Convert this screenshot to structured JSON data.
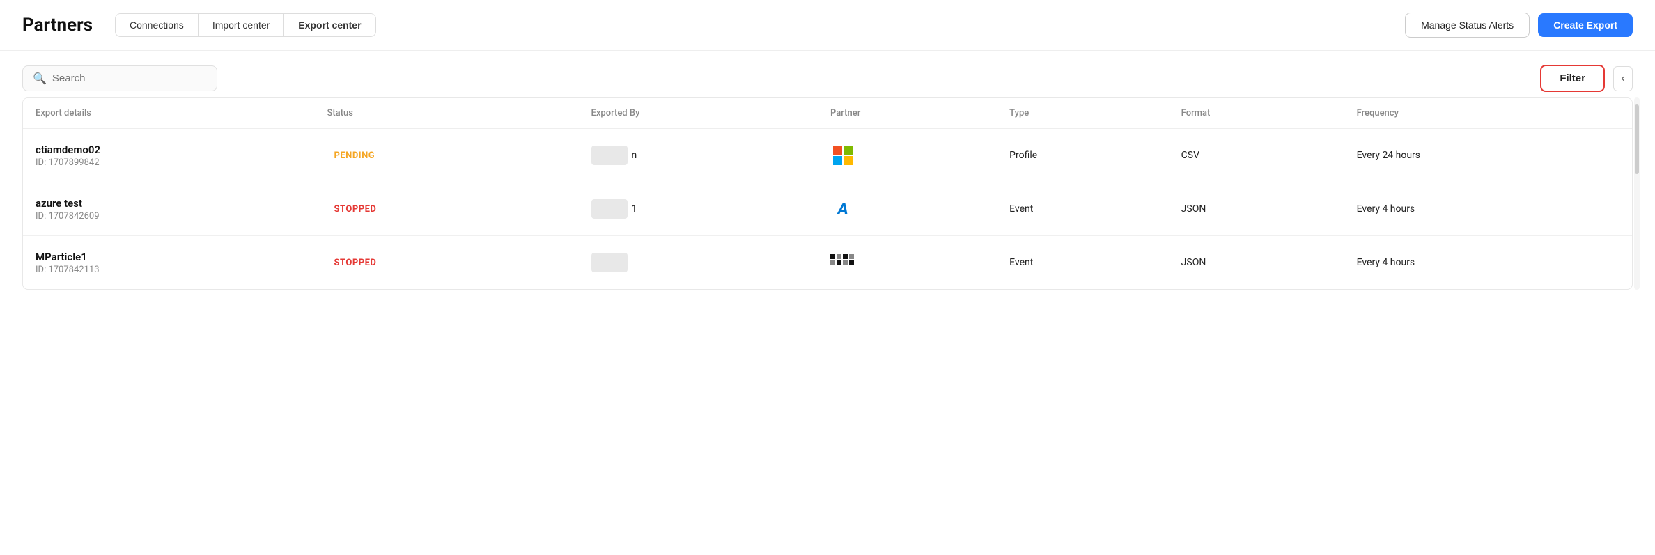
{
  "header": {
    "title": "Partners",
    "tabs": [
      {
        "id": "connections",
        "label": "Connections",
        "active": false
      },
      {
        "id": "import-center",
        "label": "Import center",
        "active": false
      },
      {
        "id": "export-center",
        "label": "Export center",
        "active": true
      }
    ],
    "actions": {
      "manage_label": "Manage Status Alerts",
      "create_label": "Create Export"
    }
  },
  "toolbar": {
    "search_placeholder": "Search",
    "filter_label": "Filter",
    "collapse_icon": "‹"
  },
  "table": {
    "columns": [
      {
        "id": "export-details",
        "label": "Export details"
      },
      {
        "id": "status",
        "label": "Status"
      },
      {
        "id": "exported-by",
        "label": "Exported By"
      },
      {
        "id": "partner",
        "label": "Partner"
      },
      {
        "id": "type",
        "label": "Type"
      },
      {
        "id": "format",
        "label": "Format"
      },
      {
        "id": "frequency",
        "label": "Frequency"
      }
    ],
    "rows": [
      {
        "id": "row-1",
        "name": "ctiamdemo02",
        "export_id": "ID: 1707899842",
        "status": "PENDING",
        "status_type": "pending",
        "exported_by": "",
        "partner_type": "microsoft",
        "type": "Profile",
        "format": "CSV",
        "frequency": "Every 24 hours"
      },
      {
        "id": "row-2",
        "name": "azure test",
        "export_id": "ID: 1707842609",
        "status": "STOPPED",
        "status_type": "stopped",
        "exported_by": "",
        "partner_type": "azure",
        "type": "Event",
        "format": "JSON",
        "frequency": "Every 4 hours"
      },
      {
        "id": "row-3",
        "name": "MParticle1",
        "export_id": "ID: 1707842113",
        "status": "STOPPED",
        "status_type": "stopped",
        "exported_by": "",
        "partner_type": "mparticle",
        "type": "Event",
        "format": "JSON",
        "frequency": "Every 4 hours"
      }
    ]
  }
}
